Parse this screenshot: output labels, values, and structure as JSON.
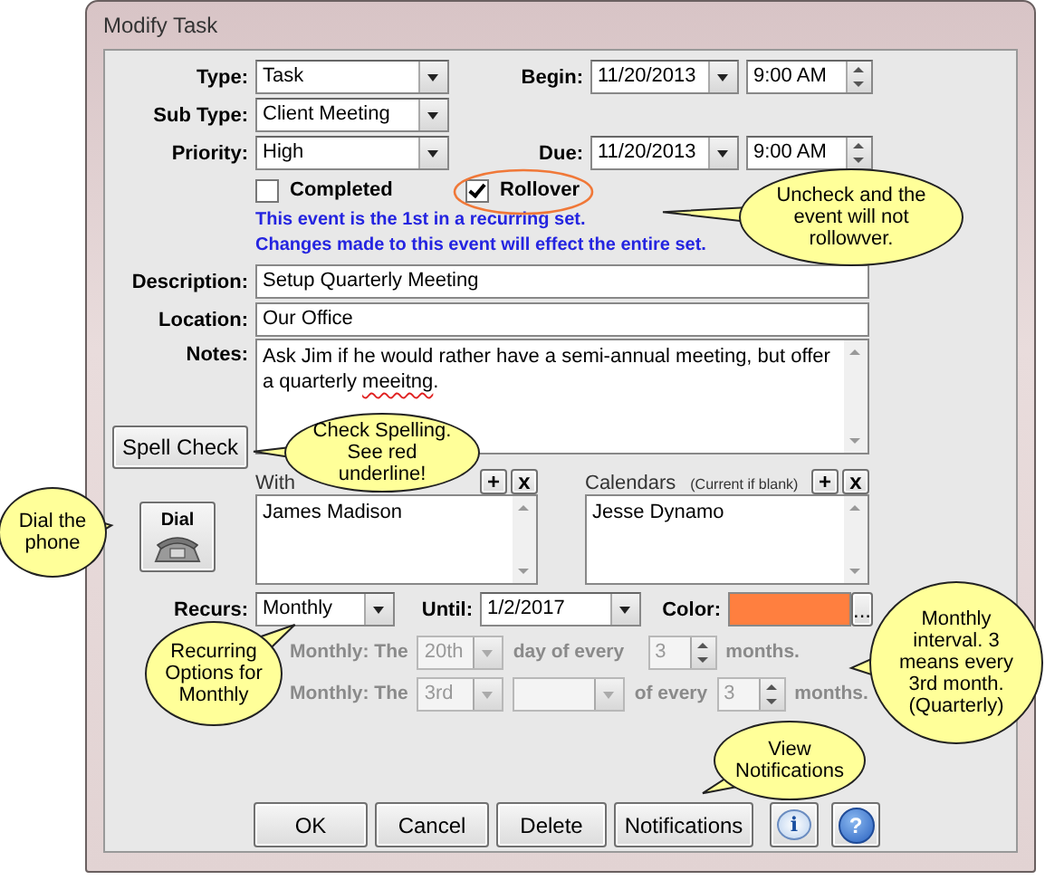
{
  "window": {
    "title": "Modify Task"
  },
  "left_fields": [
    {
      "label": "Type:",
      "value": "Task"
    },
    {
      "label": "Sub Type:",
      "value": "Client Meeting"
    },
    {
      "label": "Priority:",
      "value": "High"
    }
  ],
  "schedule": [
    {
      "label": "Begin:",
      "date": "11/20/2013",
      "time": "9:00 AM"
    },
    {
      "label": "Due:",
      "date": "11/20/2013",
      "time": "9:00 AM"
    }
  ],
  "checkboxes": [
    {
      "label": "Completed",
      "checked": false,
      "circled": false
    },
    {
      "label": "Rollover",
      "checked": true,
      "circled": true
    }
  ],
  "notices": [
    "This event is the 1st in a recurring set.",
    "Changes made to this event will effect the entire set."
  ],
  "description": {
    "label": "Description:",
    "value": "Setup Quarterly Meeting"
  },
  "location": {
    "label": "Location:",
    "value": "Our Office"
  },
  "notes": {
    "label": "Notes:",
    "text_before": "Ask Jim if he would rather have a semi-annual meeting, but offer a quarterly ",
    "misspelled_word": "meeitng",
    "text_after": "."
  },
  "spell_check_button": "Spell Check",
  "dial_button": "Dial",
  "lists": [
    {
      "label": "With",
      "add": "+",
      "remove": "x",
      "items": [
        "James Madison"
      ]
    },
    {
      "label": "Calendars",
      "hint": "(Current if blank)",
      "add": "+",
      "remove": "x",
      "items": [
        "Jesse Dynamo"
      ]
    }
  ],
  "recurrence": {
    "label": "Recurs:",
    "value": "Monthly",
    "until_label": "Until:",
    "until": "1/2/2017",
    "color_label": "Color:",
    "color": "#ff7f3f",
    "color_button": "..."
  },
  "monthly_options": [
    {
      "disabled": true,
      "parts": [
        {
          "kind": "label",
          "text": "Monthly: The"
        },
        {
          "kind": "combo",
          "text": "20th"
        },
        {
          "kind": "label",
          "text": "day of every"
        },
        {
          "kind": "spin",
          "text": "3"
        },
        {
          "kind": "label",
          "text": "months."
        }
      ]
    },
    {
      "disabled": true,
      "parts": [
        {
          "kind": "label",
          "text": "Monthly: The"
        },
        {
          "kind": "combo",
          "text": "3rd"
        },
        {
          "kind": "combo"
        },
        {
          "kind": "label",
          "text": "of every"
        },
        {
          "kind": "spin",
          "text": "3"
        },
        {
          "kind": "label",
          "text": "months."
        }
      ]
    }
  ],
  "buttons": [
    {
      "kind": "text",
      "label": "OK"
    },
    {
      "kind": "text",
      "label": "Cancel"
    },
    {
      "kind": "text",
      "label": "Delete"
    },
    {
      "kind": "text",
      "label": "Notifications"
    },
    {
      "kind": "info",
      "label": "i"
    },
    {
      "kind": "help",
      "label": "?"
    }
  ],
  "callouts": [
    "Uncheck and the event will not rollowver.",
    "Check Spelling. See red underline!",
    "Dial the phone",
    "Recurring Options for Monthly",
    "Monthly interval.  3 means every 3rd month. (Quarterly)",
    "View Notifications"
  ]
}
